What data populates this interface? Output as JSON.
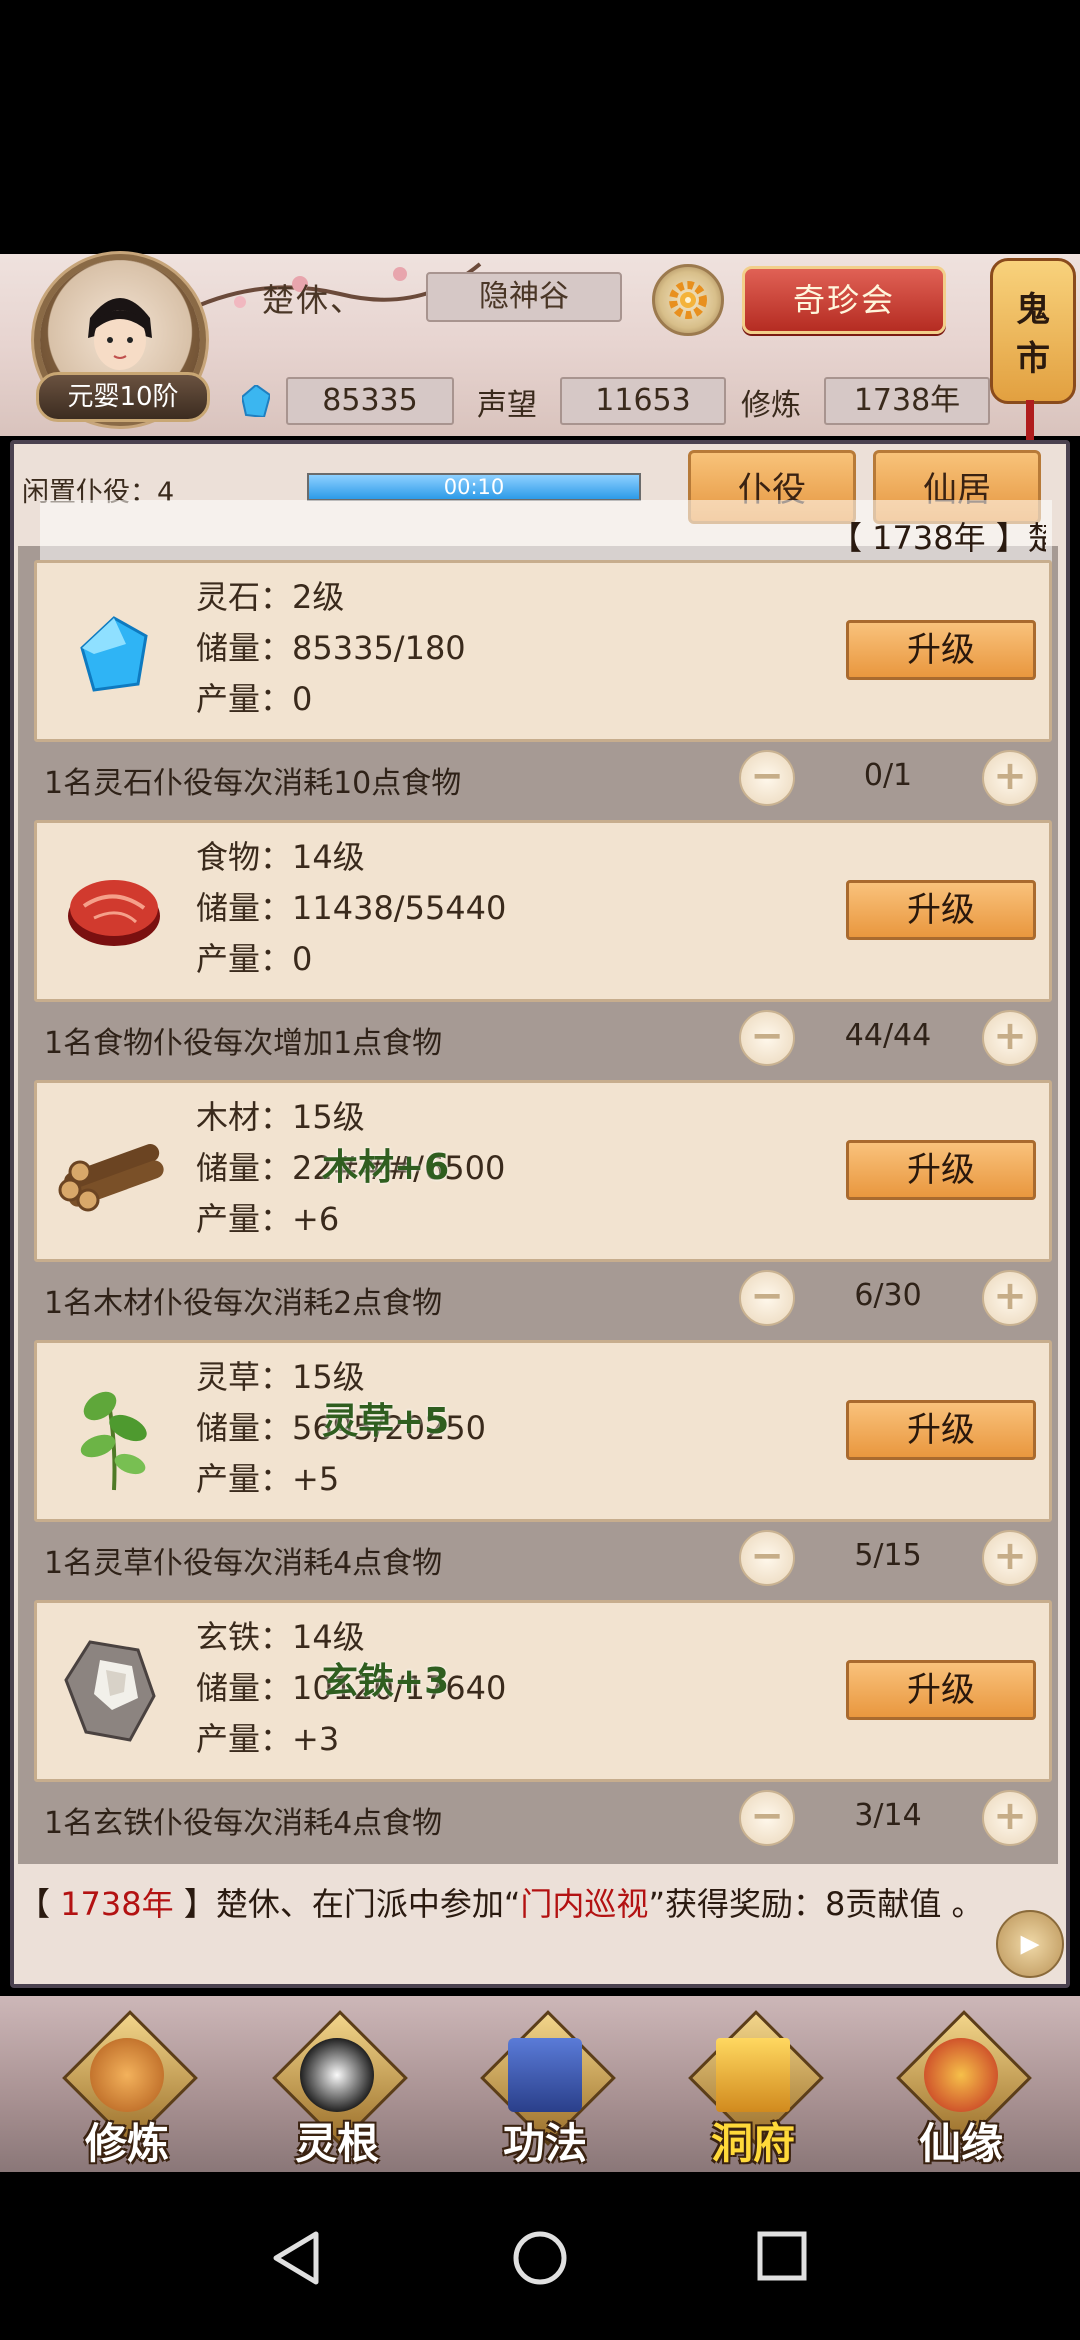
{
  "player": {
    "name": "楚休、",
    "rank": "元婴10阶",
    "sect": "隐神谷",
    "spirit_stones": "85335",
    "reputation_label": "声望",
    "reputation": "11653",
    "cultivation_label": "修炼",
    "cultivation_year": "1738年"
  },
  "header": {
    "treasure_button": "奇珍会",
    "ghost_market_line1": "鬼",
    "ghost_market_line2": "市"
  },
  "panel": {
    "idle_servants": "闲置仆役：4",
    "timer": "00:10",
    "tab_servant": "仆役",
    "tab_residence": "仙居",
    "marquee": "【 1738年 】楚"
  },
  "resources": [
    {
      "name": "灵石：2级",
      "storage": "储量：85335/180",
      "output": "产量：0",
      "upgrade": "升级",
      "worker_note": "1名灵石仆役每次消耗10点食物",
      "count": "0/1",
      "float": ""
    },
    {
      "name": "食物：14级",
      "storage": "储量：11438/55440",
      "output": "产量：0",
      "upgrade": "升级",
      "worker_note": "1名食物仆役每次增加1点食物",
      "count": "44/44",
      "float": ""
    },
    {
      "name": "木材：15级",
      "storage": "储量：22###/6500",
      "output": "产量：+6",
      "upgrade": "升级",
      "worker_note": "1名木材仆役每次消耗2点食物",
      "count": "6/30",
      "float": "木材+6"
    },
    {
      "name": "灵草：15级",
      "storage": "储量：5695/20250",
      "output": "产量：+5",
      "upgrade": "升级",
      "worker_note": "1名灵草仆役每次消耗4点食物",
      "count": "5/15",
      "float": "灵草+5"
    },
    {
      "name": "玄铁：14级",
      "storage": "储量：10120/17640",
      "output": "产量：+3",
      "upgrade": "升级",
      "worker_note": "1名玄铁仆役每次消耗4点食物",
      "count": "3/14",
      "float": "玄铁+3"
    }
  ],
  "log": {
    "open_bracket": "【 ",
    "year": "1738年",
    "close_bracket": " 】",
    "before": "楚休、在门派中参加“",
    "event": "门内巡视",
    "after": "”获得奖励：8贡献值 。"
  },
  "nav": [
    "修炼",
    "灵根",
    "功法",
    "洞府",
    "仙缘"
  ],
  "colors": {
    "accent": "#e59640",
    "log_red": "#b31212",
    "float_green": "#2f5e1f"
  }
}
